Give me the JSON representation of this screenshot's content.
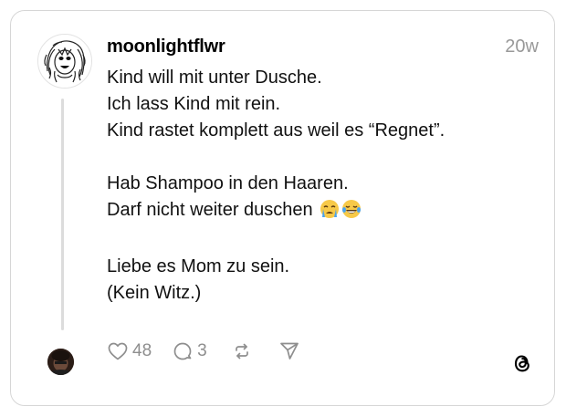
{
  "post": {
    "username": "moonlightflwr",
    "timestamp": "20w",
    "lines": [
      "Kind will mit unter Dusche.",
      "Ich lass Kind mit rein.",
      "Kind rastet komplett aus weil es “Regnet”.",
      "",
      "Hab Shampoo in den Haaren.",
      "Darf nicht weiter duschen",
      "",
      "Liebe es Mom zu sein.",
      "(Kein Witz.)"
    ],
    "emojis": [
      "crying-face-emoji",
      "tears-of-joy-emoji"
    ]
  },
  "actions": {
    "like_count": "48",
    "comment_count": "3",
    "icons": [
      "heart-icon",
      "comment-icon",
      "repost-icon",
      "share-icon"
    ]
  },
  "brand": {
    "logo": "threads-logo-icon"
  },
  "colors": {
    "border": "#d6d6d6",
    "muted": "#8e8e8e",
    "thread_line": "#dcdcdc",
    "text": "#111111"
  }
}
